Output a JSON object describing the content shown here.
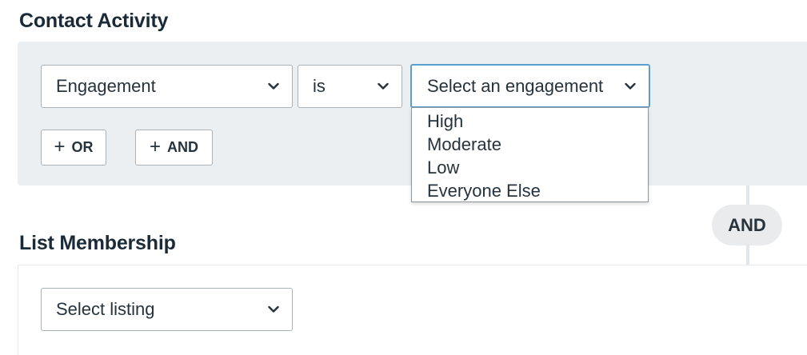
{
  "contact_activity": {
    "title": "Contact Activity",
    "field_select": {
      "value": "Engagement"
    },
    "operator_select": {
      "value": "is"
    },
    "value_select": {
      "placeholder": "Select an engagement",
      "open": true,
      "options": [
        "High",
        "Moderate",
        "Low",
        "Everyone Else"
      ]
    },
    "or_button": {
      "label": "OR"
    },
    "and_button": {
      "label": "AND"
    }
  },
  "connector": {
    "label": "AND"
  },
  "list_membership": {
    "title": "List Membership",
    "listing_select": {
      "placeholder": "Select listing"
    }
  },
  "icons": {
    "chevron": "chevron-down-icon",
    "plus": "plus-icon"
  },
  "colors": {
    "panel_bg": "#eceff1",
    "focus_border": "#5a9fcf",
    "text": "#26323c"
  }
}
